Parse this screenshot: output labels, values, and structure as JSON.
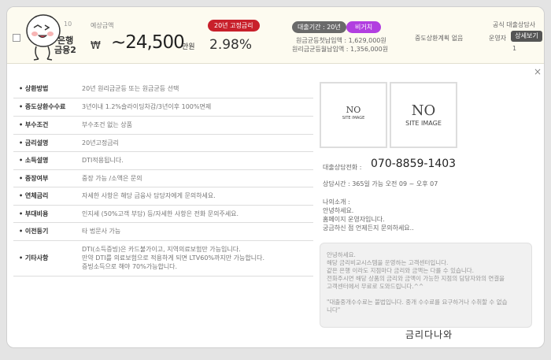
{
  "header": {
    "bank_num": "10",
    "bank_name": "은행",
    "bank_sub": "금융2",
    "est_label": "예상금액",
    "won_sign": "₩",
    "amount": "~24,500",
    "amount_unit": "만원",
    "fixed_badge": "20년 고정금리",
    "rate": "2.98%",
    "term_badge": "대출기간 : 20년",
    "face_badge": "비거치",
    "repay1": "원금균등첫납입액 : 1,629,000원",
    "repay2": "원리금균등월납입액 : 1,356,000원",
    "early": "중도상환계획 없음",
    "official": "공식 대출상담사",
    "operator": "운영자",
    "detail_btn": "상세보기",
    "count": "1"
  },
  "close_icon": "×",
  "specs": [
    {
      "key": "• 상환방법",
      "lines": [
        "20년 원리금균등 또는 원금균등 선택"
      ]
    },
    {
      "key": "• 중도상환수수료",
      "lines": [
        "3년이내 1.2%슬라이딩차감/3년이후 100%면제"
      ]
    },
    {
      "key": "• 부수조건",
      "lines": [
        "부수조건 없는 상품"
      ]
    },
    {
      "key": "• 금리설명",
      "lines": [
        "20년고정금리"
      ]
    },
    {
      "key": "• 소득설명",
      "lines": [
        "DTI적용됩니다."
      ]
    },
    {
      "key": "• 중장여부",
      "lines": [
        "중장 가능 /소액은 문의"
      ]
    },
    {
      "key": "• 연체금리",
      "lines": [
        "자세한 사항은 해당 금융사 담당자에게 문의하세요."
      ]
    },
    {
      "key": "• 부대비용",
      "lines": [
        "인지세 (50%고객 부담) 등/자세한 사항은 전화 문의주세요."
      ]
    },
    {
      "key": "• 이전등기",
      "lines": [
        "타 법문사 가능"
      ]
    },
    {
      "key": "• 기타사항",
      "lines": [
        "DTI(소득증빙)은 카드불가이고, 지역의료보험만 가능입니다.",
        "만약 DTI를 의료보험으로 적용하게 되면 LTV60%까지만 가능합니다.",
        "증빙소득으로 해야 70%가능합니다."
      ]
    }
  ],
  "images": [
    {
      "line1": "NO",
      "line2": "SITE IMAGE"
    },
    {
      "line1": "NO",
      "line2": "SITE IMAGE"
    }
  ],
  "contact": {
    "phone_label": "대출상담전화 :",
    "phone": "070-8859-1403",
    "hours": "상담시간 : 365일 가능 오전 09 ~ 오후 07"
  },
  "intro_lines": [
    "나의소개 :",
    "안녕하세요.",
    "홈페이지 운영자입니다.",
    "궁금하신 점 언제든지 문의하세요.."
  ],
  "notice_lines": [
    "안녕하세요.",
    "해당 금리비교시스템을 운영하는 고객센터입니다.",
    "같은 은행 이라도 지점마다 금리와 금액는 다를 수 있습니다.",
    "전화주시면 해당 상품의 금리와 금액이 가능한 지점의 담당자와의 연결을",
    "고객센터에서 무료로 도와드립니다.^^",
    "",
    "\"대출중개수수료는 불법입니다. 중개 수수료를 요구하거나 수취할 수 없습",
    "니다\""
  ],
  "watermark": "금리다나와"
}
